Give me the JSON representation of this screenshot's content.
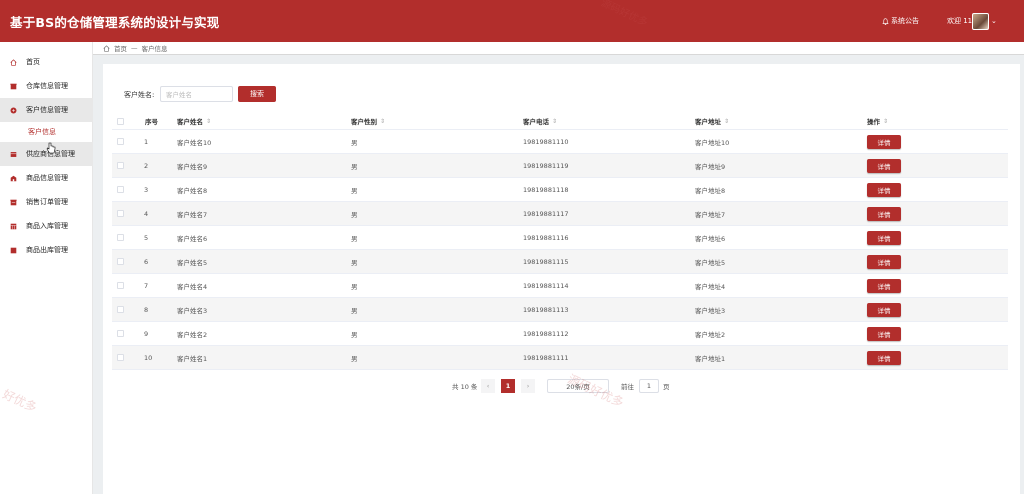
{
  "header": {
    "title": "基于BS的仓储管理系统的设计与实现",
    "notice": "系统公告",
    "welcome": "欢迎 11"
  },
  "sidebar": {
    "items": [
      {
        "label": "首页",
        "icon": "home-icon"
      },
      {
        "label": "仓库信息管理",
        "icon": "warehouse-icon"
      },
      {
        "label": "客户信息管理",
        "icon": "customer-icon"
      },
      {
        "label": "供应商信息管理",
        "icon": "supplier-icon"
      },
      {
        "label": "商品信息管理",
        "icon": "goods-icon"
      },
      {
        "label": "销售订单管理",
        "icon": "order-icon"
      },
      {
        "label": "商品入库管理",
        "icon": "stock-in-icon"
      },
      {
        "label": "商品出库管理",
        "icon": "stock-out-icon"
      }
    ],
    "sub_item": "客户信息"
  },
  "breadcrumb": {
    "home": "首页",
    "separator": "—",
    "current": "客户信息"
  },
  "search": {
    "label": "客户姓名:",
    "placeholder": "客户姓名",
    "button": "搜索"
  },
  "table": {
    "columns": [
      "序号",
      "客户姓名",
      "客户性别",
      "客户电话",
      "客户地址",
      "操作"
    ],
    "detail_label": "详情",
    "rows": [
      {
        "no": "1",
        "name": "客户姓名10",
        "gender": "男",
        "phone": "19819881110",
        "address": "客户地址10"
      },
      {
        "no": "2",
        "name": "客户姓名9",
        "gender": "男",
        "phone": "19819881119",
        "address": "客户地址9"
      },
      {
        "no": "3",
        "name": "客户姓名8",
        "gender": "男",
        "phone": "19819881118",
        "address": "客户地址8"
      },
      {
        "no": "4",
        "name": "客户姓名7",
        "gender": "男",
        "phone": "19819881117",
        "address": "客户地址7"
      },
      {
        "no": "5",
        "name": "客户姓名6",
        "gender": "男",
        "phone": "19819881116",
        "address": "客户地址6"
      },
      {
        "no": "6",
        "name": "客户姓名5",
        "gender": "男",
        "phone": "19819881115",
        "address": "客户地址5"
      },
      {
        "no": "7",
        "name": "客户姓名4",
        "gender": "男",
        "phone": "19819881114",
        "address": "客户地址4"
      },
      {
        "no": "8",
        "name": "客户姓名3",
        "gender": "男",
        "phone": "19819881113",
        "address": "客户地址3"
      },
      {
        "no": "9",
        "name": "客户姓名2",
        "gender": "男",
        "phone": "19819881112",
        "address": "客户地址2"
      },
      {
        "no": "10",
        "name": "客户姓名1",
        "gender": "男",
        "phone": "19819881111",
        "address": "客户地址1"
      }
    ]
  },
  "pagination": {
    "total": "共 10 条",
    "prev": "‹",
    "current_page": "1",
    "next": "›",
    "page_size": "20条/页",
    "goto_label": "前往",
    "goto_value": "1",
    "goto_unit": "页"
  },
  "watermarks": [
    "源码好优多",
    "源码好优多",
    "好优多"
  ],
  "colors": {
    "primary": "#b22e2c",
    "content_bg": "#eceff1"
  }
}
